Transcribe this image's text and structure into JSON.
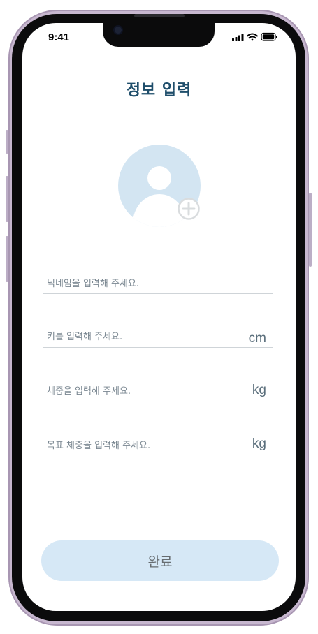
{
  "status_bar": {
    "time": "9:41"
  },
  "header": {
    "title": "정보 입력"
  },
  "profile": {
    "avatar_icon": "user-avatar-icon",
    "add_icon": "plus-circle-icon"
  },
  "form": {
    "nickname": {
      "placeholder": "닉네임을 입력해 주세요.",
      "unit": ""
    },
    "height": {
      "placeholder": "키를 입력해 주세요.",
      "unit": "cm"
    },
    "weight": {
      "placeholder": "체중을 입력해 주세요.",
      "unit": "kg"
    },
    "goal_weight": {
      "placeholder": "목표 체중을 입력해 주세요.",
      "unit": "kg"
    }
  },
  "footer": {
    "submit_label": "완료"
  },
  "colors": {
    "title": "#1f4e6b",
    "accent_light": "#d6e8f6",
    "avatar": "#d3e5f2"
  }
}
